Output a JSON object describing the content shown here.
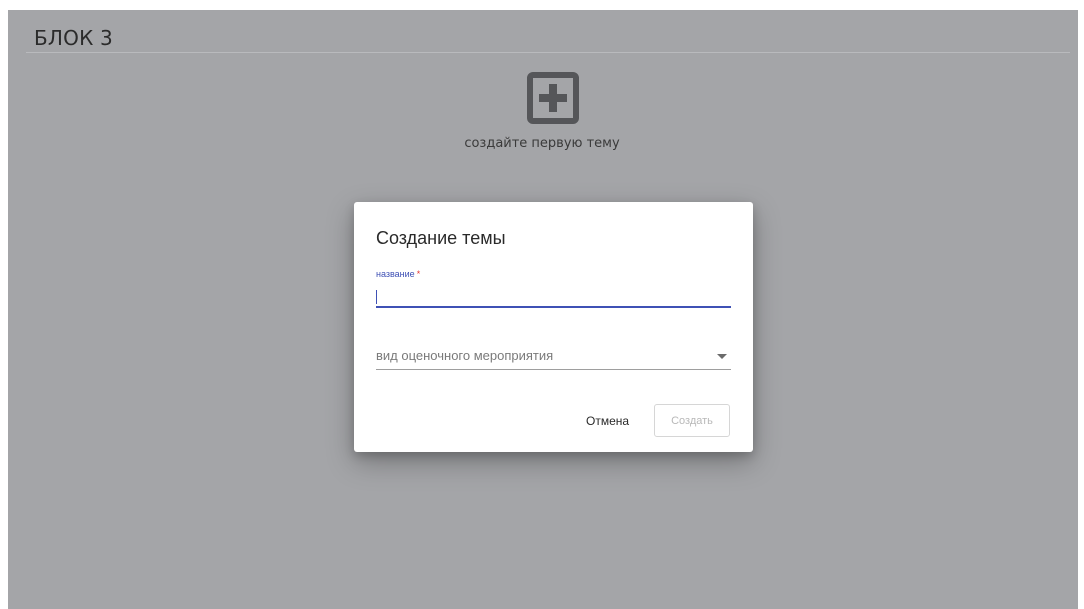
{
  "block": {
    "title": "БЛОК 3",
    "add_icon": "plus-box-icon",
    "empty_hint": "создайте первую тему"
  },
  "dialog": {
    "title": "Создание темы",
    "name_field": {
      "label": "название",
      "required_mark": "*",
      "value": ""
    },
    "type_select": {
      "placeholder": "вид оценочного мероприятия",
      "icon": "caret-down-icon"
    },
    "cancel_label": "Отмена",
    "create_label": "Создать"
  },
  "colors": {
    "overlay_gray": "#a4a5a8",
    "accent": "#3f51b5",
    "required": "#e53935",
    "disabled_text": "#b8b8b8"
  }
}
